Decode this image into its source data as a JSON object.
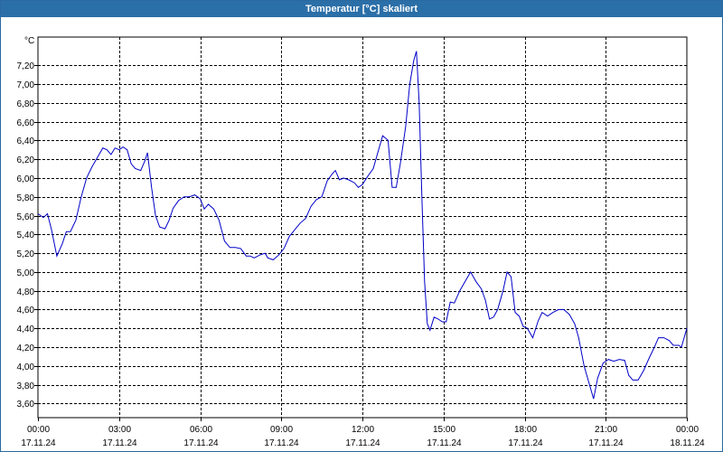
{
  "window": {
    "title": "Temperatur [°C] skaliert"
  },
  "colors": {
    "titlebar": "#2b6fa8",
    "line": "#0000c8",
    "grid": "#000000"
  },
  "chart_data": {
    "type": "line",
    "title": "Temperatur [°C] skaliert",
    "ylabel": "°C",
    "xlabel": "",
    "ylim": [
      3.45,
      7.5
    ],
    "y_ticks": [
      "3,60",
      "3,80",
      "4,00",
      "4,20",
      "4,40",
      "4,60",
      "4,80",
      "5,00",
      "5,20",
      "5,40",
      "5,60",
      "5,80",
      "6,00",
      "6,20",
      "6,40",
      "6,60",
      "6,80",
      "7,00",
      "7,20"
    ],
    "y_tick_values": [
      3.6,
      3.8,
      4.0,
      4.2,
      4.4,
      4.6,
      4.8,
      5.0,
      5.2,
      5.4,
      5.6,
      5.8,
      6.0,
      6.2,
      6.4,
      6.6,
      6.8,
      7.0,
      7.2
    ],
    "x_range_hours": [
      0,
      24
    ],
    "x_ticks": [
      {
        "time": "00:00",
        "date": "17.11.24",
        "hour": 0
      },
      {
        "time": "03:00",
        "date": "17.11.24",
        "hour": 3
      },
      {
        "time": "06:00",
        "date": "17.11.24",
        "hour": 6
      },
      {
        "time": "09:00",
        "date": "17.11.24",
        "hour": 9
      },
      {
        "time": "12:00",
        "date": "17.11.24",
        "hour": 12
      },
      {
        "time": "15:00",
        "date": "17.11.24",
        "hour": 15
      },
      {
        "time": "18:00",
        "date": "17.11.24",
        "hour": 18
      },
      {
        "time": "21:00",
        "date": "17.11.24",
        "hour": 21
      },
      {
        "time": "00:00",
        "date": "18.11.24",
        "hour": 24
      }
    ],
    "grid": true,
    "series": [
      {
        "values": [
          [
            0.0,
            5.62
          ],
          [
            0.2,
            5.58
          ],
          [
            0.35,
            5.62
          ],
          [
            0.5,
            5.45
          ],
          [
            0.7,
            5.17
          ],
          [
            0.9,
            5.3
          ],
          [
            1.05,
            5.43
          ],
          [
            1.2,
            5.43
          ],
          [
            1.4,
            5.55
          ],
          [
            1.6,
            5.8
          ],
          [
            1.8,
            6.0
          ],
          [
            2.0,
            6.12
          ],
          [
            2.2,
            6.22
          ],
          [
            2.4,
            6.32
          ],
          [
            2.55,
            6.3
          ],
          [
            2.7,
            6.25
          ],
          [
            2.85,
            6.32
          ],
          [
            3.0,
            6.3
          ],
          [
            3.15,
            6.33
          ],
          [
            3.3,
            6.3
          ],
          [
            3.45,
            6.15
          ],
          [
            3.6,
            6.1
          ],
          [
            3.8,
            6.08
          ],
          [
            3.95,
            6.18
          ],
          [
            4.05,
            6.27
          ],
          [
            4.2,
            5.9
          ],
          [
            4.35,
            5.6
          ],
          [
            4.5,
            5.48
          ],
          [
            4.7,
            5.46
          ],
          [
            4.85,
            5.55
          ],
          [
            5.0,
            5.68
          ],
          [
            5.2,
            5.76
          ],
          [
            5.4,
            5.8
          ],
          [
            5.6,
            5.8
          ],
          [
            5.8,
            5.82
          ],
          [
            6.0,
            5.78
          ],
          [
            6.15,
            5.67
          ],
          [
            6.3,
            5.72
          ],
          [
            6.5,
            5.67
          ],
          [
            6.7,
            5.55
          ],
          [
            6.9,
            5.33
          ],
          [
            7.1,
            5.26
          ],
          [
            7.3,
            5.26
          ],
          [
            7.5,
            5.25
          ],
          [
            7.7,
            5.17
          ],
          [
            7.85,
            5.17
          ],
          [
            8.0,
            5.15
          ],
          [
            8.2,
            5.18
          ],
          [
            8.4,
            5.2
          ],
          [
            8.5,
            5.15
          ],
          [
            8.7,
            5.13
          ],
          [
            8.9,
            5.18
          ],
          [
            9.1,
            5.25
          ],
          [
            9.3,
            5.38
          ],
          [
            9.5,
            5.45
          ],
          [
            9.7,
            5.52
          ],
          [
            9.9,
            5.57
          ],
          [
            10.1,
            5.7
          ],
          [
            10.3,
            5.77
          ],
          [
            10.5,
            5.8
          ],
          [
            10.7,
            5.97
          ],
          [
            10.9,
            6.05
          ],
          [
            11.0,
            6.08
          ],
          [
            11.15,
            5.98
          ],
          [
            11.3,
            6.0
          ],
          [
            11.5,
            5.98
          ],
          [
            11.7,
            5.95
          ],
          [
            11.85,
            5.9
          ],
          [
            12.0,
            5.93
          ],
          [
            12.2,
            6.02
          ],
          [
            12.4,
            6.1
          ],
          [
            12.6,
            6.3
          ],
          [
            12.75,
            6.45
          ],
          [
            12.95,
            6.4
          ],
          [
            13.1,
            5.9
          ],
          [
            13.25,
            5.9
          ],
          [
            13.4,
            6.15
          ],
          [
            13.6,
            6.55
          ],
          [
            13.75,
            7.0
          ],
          [
            13.9,
            7.25
          ],
          [
            14.0,
            7.35
          ],
          [
            14.1,
            6.8
          ],
          [
            14.2,
            5.8
          ],
          [
            14.3,
            4.9
          ],
          [
            14.4,
            4.45
          ],
          [
            14.5,
            4.38
          ],
          [
            14.65,
            4.52
          ],
          [
            14.8,
            4.5
          ],
          [
            14.95,
            4.47
          ],
          [
            15.1,
            4.47
          ],
          [
            15.25,
            4.68
          ],
          [
            15.4,
            4.67
          ],
          [
            15.6,
            4.8
          ],
          [
            15.8,
            4.9
          ],
          [
            16.0,
            5.0
          ],
          [
            16.2,
            4.9
          ],
          [
            16.4,
            4.82
          ],
          [
            16.55,
            4.7
          ],
          [
            16.7,
            4.5
          ],
          [
            16.85,
            4.52
          ],
          [
            17.0,
            4.6
          ],
          [
            17.2,
            4.8
          ],
          [
            17.35,
            5.0
          ],
          [
            17.5,
            4.95
          ],
          [
            17.65,
            4.57
          ],
          [
            17.8,
            4.53
          ],
          [
            17.95,
            4.42
          ],
          [
            18.1,
            4.4
          ],
          [
            18.3,
            4.3
          ],
          [
            18.5,
            4.48
          ],
          [
            18.65,
            4.57
          ],
          [
            18.85,
            4.53
          ],
          [
            19.05,
            4.57
          ],
          [
            19.25,
            4.6
          ],
          [
            19.45,
            4.6
          ],
          [
            19.65,
            4.55
          ],
          [
            19.85,
            4.45
          ],
          [
            20.0,
            4.3
          ],
          [
            20.2,
            4.0
          ],
          [
            20.4,
            3.8
          ],
          [
            20.55,
            3.65
          ],
          [
            20.7,
            3.87
          ],
          [
            20.9,
            4.03
          ],
          [
            21.1,
            4.07
          ],
          [
            21.3,
            4.05
          ],
          [
            21.5,
            4.07
          ],
          [
            21.7,
            4.06
          ],
          [
            21.85,
            3.9
          ],
          [
            22.0,
            3.85
          ],
          [
            22.2,
            3.85
          ],
          [
            22.4,
            3.95
          ],
          [
            22.6,
            4.08
          ],
          [
            22.8,
            4.2
          ],
          [
            22.95,
            4.3
          ],
          [
            23.15,
            4.3
          ],
          [
            23.35,
            4.27
          ],
          [
            23.5,
            4.22
          ],
          [
            23.7,
            4.22
          ],
          [
            23.8,
            4.2
          ],
          [
            24.0,
            4.4
          ]
        ]
      }
    ]
  }
}
